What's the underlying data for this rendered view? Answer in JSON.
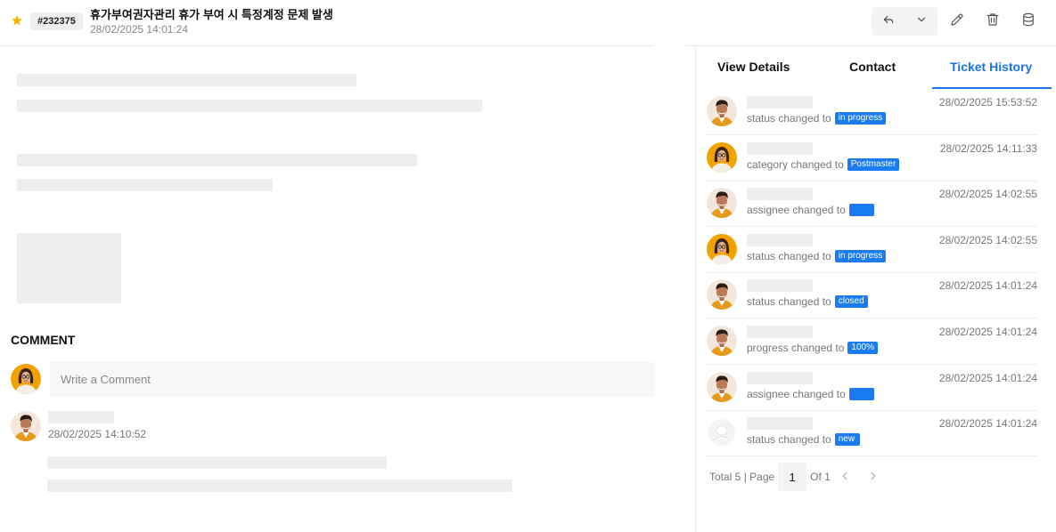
{
  "header": {
    "ticket_id": "#232375",
    "title": "휴가부여권자관리 휴가 부여 시 특정계정 문제 발생",
    "date": "28/02/2025 14:01:24"
  },
  "icons": {
    "star": "star-icon",
    "reply": "reply-icon",
    "chevron": "chevron-down-icon",
    "edit": "pencil-icon",
    "delete": "trash-icon",
    "database": "database-icon"
  },
  "colors": {
    "accent": "#1a73e8",
    "badge": "#1a7cf0",
    "star": "#f5b400"
  },
  "comment": {
    "heading": "COMMENT",
    "input_placeholder": "Write a Comment",
    "entries": [
      {
        "date": "28/02/2025 14:10:52"
      }
    ]
  },
  "tabs": [
    {
      "label": "View Details",
      "active": false
    },
    {
      "label": "Contact",
      "active": false
    },
    {
      "label": "Ticket History",
      "active": true
    }
  ],
  "history": [
    {
      "text": "status changed to",
      "badge": "in progress",
      "time": "28/02/2025 15:53:52",
      "avatar": "male"
    },
    {
      "text": "category changed to",
      "badge": "Postmaster",
      "time": "28/02/2025 14:11:33",
      "avatar": "female"
    },
    {
      "text": "assignee changed to",
      "badge": "",
      "time": "28/02/2025 14:02:55",
      "avatar": "male"
    },
    {
      "text": "status changed to",
      "badge": "in progress",
      "time": "28/02/2025 14:02:55",
      "avatar": "female"
    },
    {
      "text": "status changed to",
      "badge": "closed",
      "time": "28/02/2025 14:01:24",
      "avatar": "male"
    },
    {
      "text": "progress changed to",
      "badge": "100%",
      "time": "28/02/2025 14:01:24",
      "avatar": "male"
    },
    {
      "text": "assignee changed to",
      "badge": "",
      "time": "28/02/2025 14:01:24",
      "avatar": "male"
    },
    {
      "text": "status changed to",
      "badge": "new",
      "time": "28/02/2025 14:01:24",
      "avatar": "placeholder"
    }
  ],
  "pager": {
    "total_label": "Total 5 | Page",
    "current_page": "1",
    "of_label": "Of 1"
  }
}
